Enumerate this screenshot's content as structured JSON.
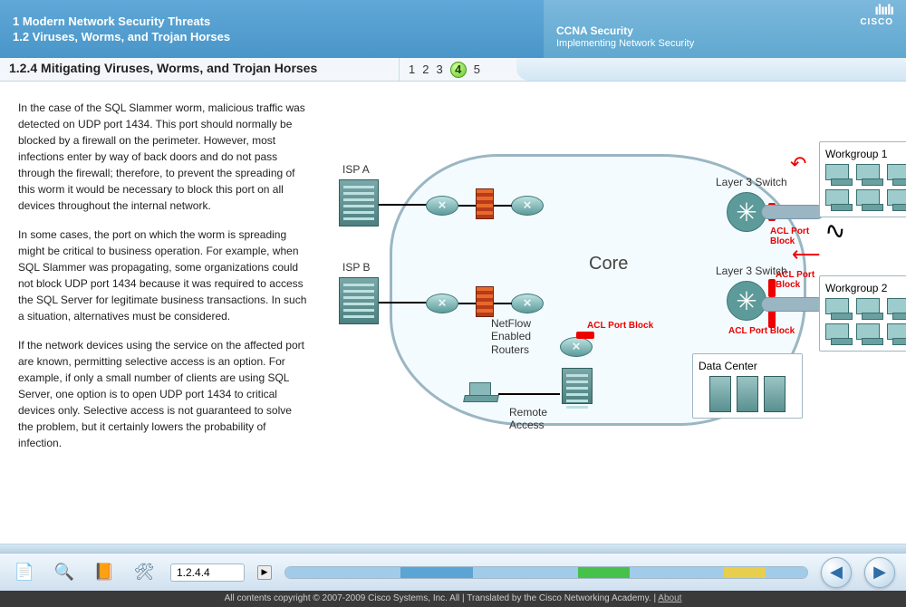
{
  "header": {
    "chapter": "1 Modern Network Security Threats",
    "section": "1.2 Viruses, Worms, and Trojan Horses",
    "course": "CCNA Security",
    "subtitle": "Implementing Network Security",
    "logo_text": "CISCO"
  },
  "subhead": {
    "title": "1.2.4 Mitigating Viruses, Worms, and Trojan Horses",
    "pages": [
      "1",
      "2",
      "3",
      "4",
      "5"
    ],
    "active_page": "4"
  },
  "content": {
    "para1": "In the case of the SQL Slammer worm, malicious traffic was detected on UDP port 1434. This port should normally be blocked by a firewall on the perimeter. However, most infections enter by way of back doors and do not pass through the firewall; therefore, to prevent the spreading of this worm it would be necessary to block this port on all devices throughout the internal network.",
    "para2": "In some cases, the port on which the worm is spreading might be critical to business operation. For example, when SQL Slammer was propagating, some organizations could not block UDP port 1434 because it was required to access the SQL Server for legitimate business transactions. In such a situation, alternatives must be considered.",
    "para3": "If the network devices using the service on the affected port are known, permitting selective access is an option. For example, if only a small number of clients are using SQL Server, one option is to open UDP port 1434 to critical devices only. Selective access is not guaranteed to solve the problem, but it certainly lowers the probability of infection."
  },
  "diagram": {
    "isp_a": "ISP A",
    "isp_b": "ISP B",
    "netflow": "NetFlow\nEnabled\nRouters",
    "remote_access": "Remote\nAccess",
    "core": "Core",
    "l3_switch": "Layer 3 Switch",
    "acl_port_block": "ACL Port Block",
    "acl_port_block_short": "ACL Port\nBlock",
    "data_center": "Data Center",
    "workgroup1": "Workgroup 1",
    "workgroup2": "Workgroup 2"
  },
  "toolbar": {
    "icons": {
      "index": "index-icon",
      "search": "search-icon",
      "glossary": "glossary-icon",
      "tools": "tools-icon"
    },
    "location": "1.2.4.4",
    "progress_segments": [
      {
        "color": "#a0ccea",
        "w": 22
      },
      {
        "color": "#5aa4d6",
        "w": 14
      },
      {
        "color": "#a0ccea",
        "w": 20
      },
      {
        "color": "#46c24a",
        "w": 10
      },
      {
        "color": "#a0ccea",
        "w": 18
      },
      {
        "color": "#e7cf4d",
        "w": 8
      },
      {
        "color": "#a0ccea",
        "w": 8
      }
    ]
  },
  "footer": {
    "copyright": "All contents copyright © 2007-2009 Cisco Systems, Inc. All | Translated by the Cisco Networking Academy. | ",
    "about": "About"
  }
}
